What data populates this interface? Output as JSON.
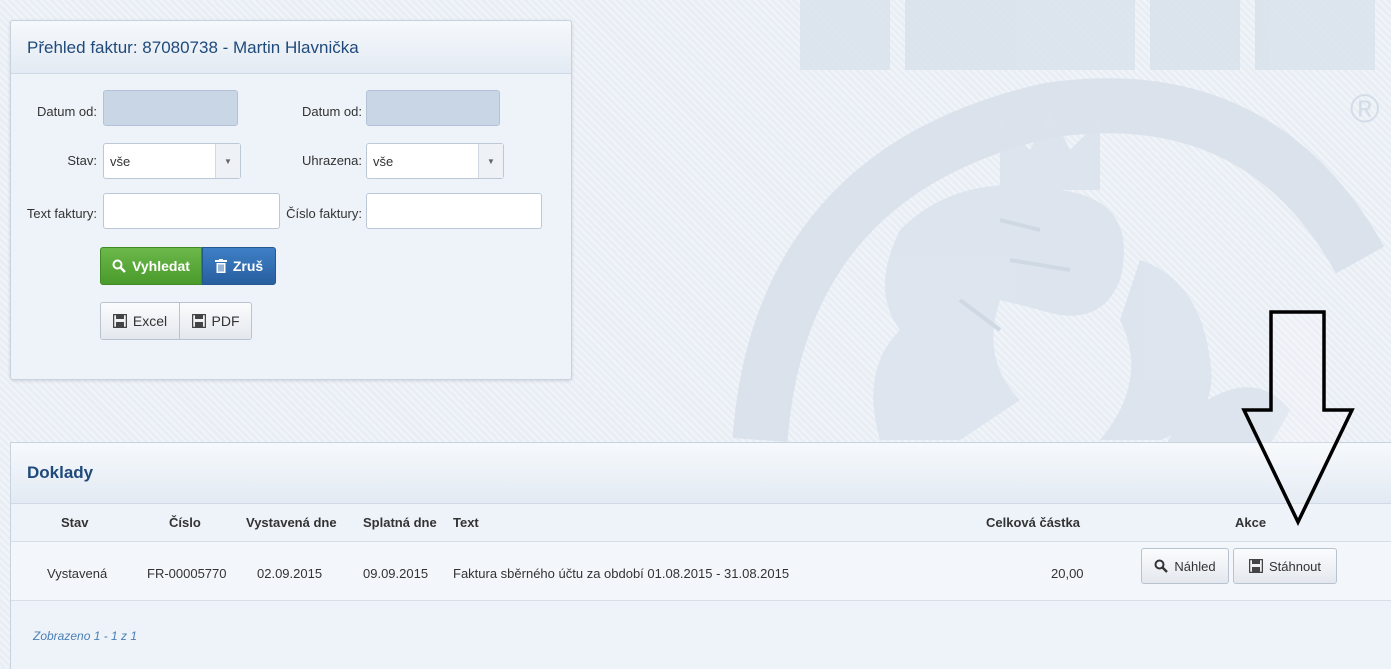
{
  "filter": {
    "title": "Přehled faktur: 87080738 - Martin Hlavnička",
    "date_from_label": "Datum od:",
    "date_from2_label": "Datum od:",
    "date_from_value": "",
    "date_from2_value": "",
    "stav_label": "Stav:",
    "stav_value": "vše",
    "uhrazena_label": "Uhrazena:",
    "uhrazena_value": "vše",
    "text_label": "Text faktury:",
    "text_value": "",
    "cislo_label": "Číslo faktury:",
    "cislo_value": "",
    "search_label": "Vyhledat",
    "cancel_label": "Zruš",
    "excel_label": "Excel",
    "pdf_label": "PDF"
  },
  "docs": {
    "title": "Doklady",
    "columns": [
      "Stav",
      "Číslo",
      "Vystavená dne",
      "Splatná dne",
      "Text",
      "Celková částka",
      "Akce"
    ],
    "rows": [
      {
        "stav": "Vystavená",
        "cislo": "FR-00005770",
        "vystavena": "02.09.2015",
        "splatna": "09.09.2015",
        "text": "Faktura sběrného účtu za období 01.08.2015 - 31.08.2015",
        "castka": "20,00",
        "preview_label": "Náhled",
        "download_label": "Stáhnout"
      }
    ],
    "footer": "Zobrazeno 1 - 1 z 1"
  },
  "colors": {
    "accent": "#1f4a7a",
    "search_button": "#5aa83a",
    "cancel_button": "#2f6db0",
    "background": "#e9eef5"
  },
  "icons": [
    "search-icon",
    "trash-icon",
    "floppy-disk-icon",
    "registered-icon",
    "down-arrow-annotation"
  ]
}
